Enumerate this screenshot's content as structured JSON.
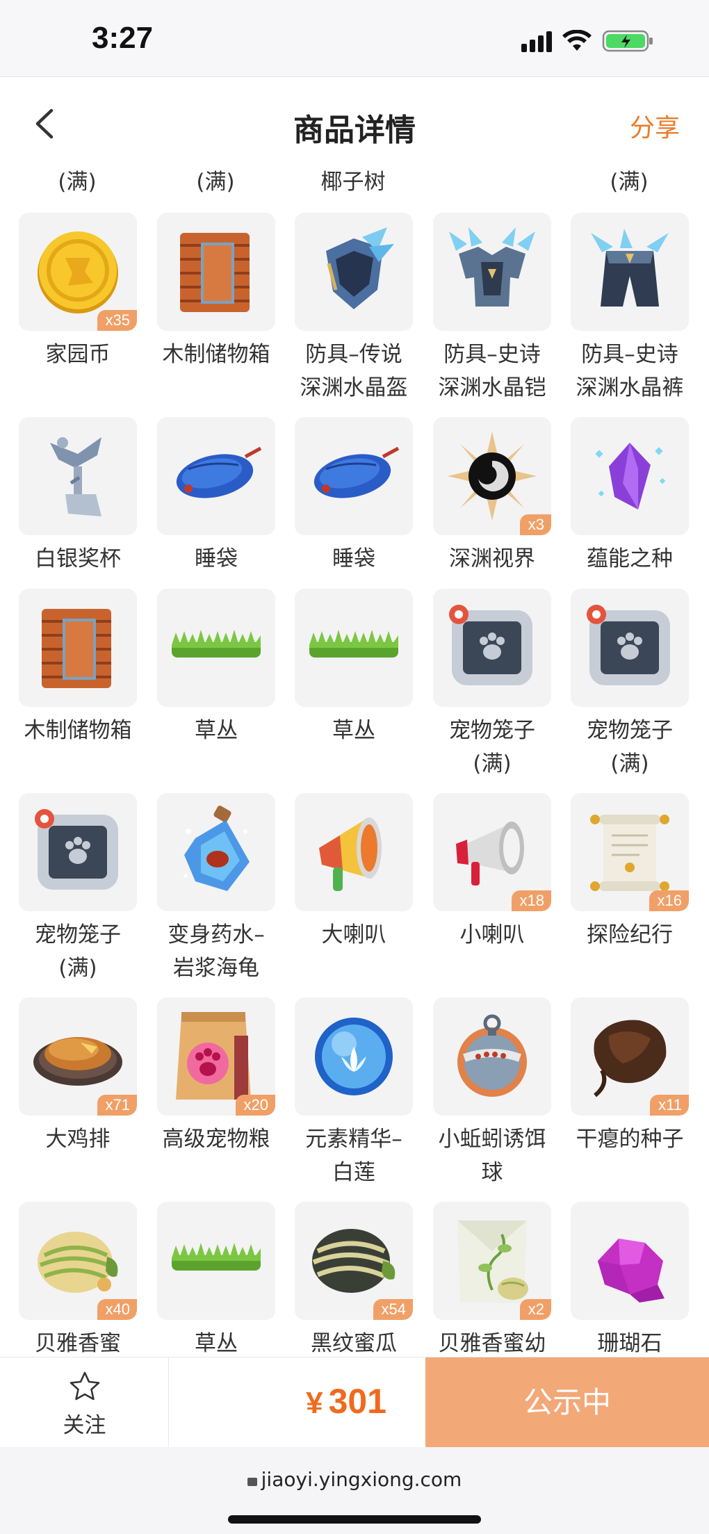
{
  "status_bar": {
    "time": "3:27"
  },
  "header": {
    "title": "商品详情",
    "share_label": "分享"
  },
  "top_row_labels": [
    "(满)",
    "(满)",
    "椰子树",
    "",
    "(满)"
  ],
  "items": [
    {
      "name": "家园币",
      "qty": "x35",
      "icon": "gold-coin-icon"
    },
    {
      "name": "木制储物箱",
      "qty": "",
      "icon": "wooden-crate-icon"
    },
    {
      "name": "防具–传说\n深渊水晶盔",
      "qty": "",
      "icon": "crystal-helmet-icon"
    },
    {
      "name": "防具–史诗\n深渊水晶铠",
      "qty": "",
      "icon": "crystal-armor-icon"
    },
    {
      "name": "防具–史诗\n深渊水晶裤",
      "qty": "",
      "icon": "crystal-pants-icon"
    },
    {
      "name": "白银奖杯",
      "qty": "",
      "icon": "silver-trophy-icon"
    },
    {
      "name": "睡袋",
      "qty": "",
      "icon": "sleeping-bag-icon"
    },
    {
      "name": "睡袋",
      "qty": "",
      "icon": "sleeping-bag-icon"
    },
    {
      "name": "深渊视界",
      "qty": "x3",
      "icon": "abyss-vortex-icon"
    },
    {
      "name": "蕴能之种",
      "qty": "",
      "icon": "purple-crystal-icon"
    },
    {
      "name": "木制储物箱",
      "qty": "",
      "icon": "wooden-crate-icon"
    },
    {
      "name": "草丛",
      "qty": "",
      "icon": "grass-icon"
    },
    {
      "name": "草丛",
      "qty": "",
      "icon": "grass-icon"
    },
    {
      "name": "宠物笼子\n(满)",
      "qty": "",
      "icon": "pet-cage-icon"
    },
    {
      "name": "宠物笼子\n(满)",
      "qty": "",
      "icon": "pet-cage-icon"
    },
    {
      "name": "宠物笼子\n(满)",
      "qty": "",
      "icon": "pet-cage-icon"
    },
    {
      "name": "变身药水–\n岩浆海龟",
      "qty": "",
      "icon": "potion-bottle-icon"
    },
    {
      "name": "大喇叭",
      "qty": "",
      "icon": "big-megaphone-icon"
    },
    {
      "name": "小喇叭",
      "qty": "x18",
      "icon": "small-megaphone-icon"
    },
    {
      "name": "探险纪行",
      "qty": "x16",
      "icon": "scroll-icon"
    },
    {
      "name": "大鸡排",
      "qty": "x71",
      "icon": "chicken-cutlet-icon"
    },
    {
      "name": "高级宠物粮",
      "qty": "x20",
      "icon": "pet-food-bag-icon"
    },
    {
      "name": "元素精华–\n白莲",
      "qty": "",
      "icon": "lotus-orb-icon"
    },
    {
      "name": "小蚯蚓诱饵\n球",
      "qty": "",
      "icon": "bait-ball-icon"
    },
    {
      "name": "干瘪的种子",
      "qty": "x11",
      "icon": "dried-seed-icon"
    },
    {
      "name": "贝雅香蜜",
      "qty": "x40",
      "icon": "melon-icon"
    },
    {
      "name": "草丛",
      "qty": "",
      "icon": "grass-icon"
    },
    {
      "name": "黑纹蜜瓜",
      "qty": "x54",
      "icon": "dark-melon-icon"
    },
    {
      "name": "贝雅香蜜幼",
      "qty": "x2",
      "icon": "seed-packet-icon"
    },
    {
      "name": "珊瑚石",
      "qty": "",
      "icon": "coral-stone-icon"
    }
  ],
  "action_bar": {
    "follow_label": "关注",
    "currency": "¥",
    "price": "301",
    "status_label": "公示中"
  },
  "browser": {
    "url": "jiaoyi.yingxiong.com"
  },
  "colors": {
    "accent": "#ea7b2a",
    "price": "#ee6b1f",
    "status_button": "#f3a877",
    "qty_badge": "#f0a067"
  }
}
